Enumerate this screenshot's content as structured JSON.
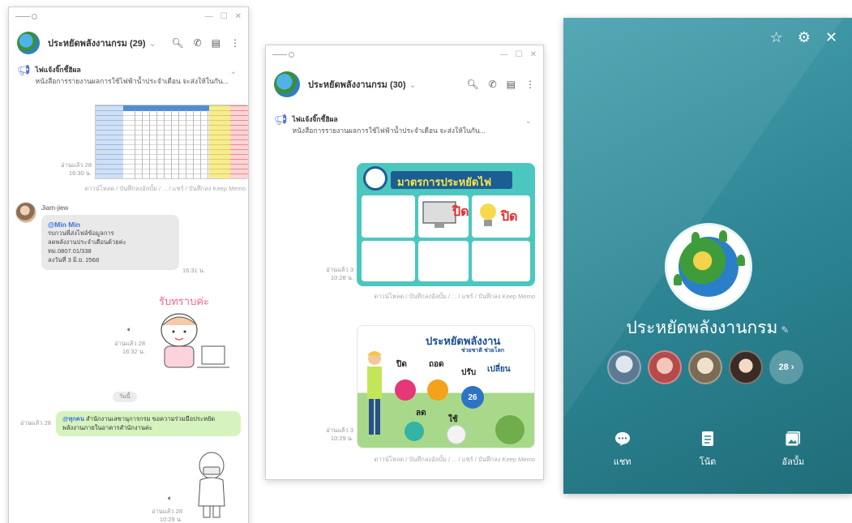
{
  "window1": {
    "chat_title": "ประหยัดพลังงานกรม (29)",
    "announcement_title": "ไฟแจ้งจิ๊กชี้ฮิผล",
    "announcement_text": "หนังสือการรายงานผลการใช้ไฟฟ้าน้ำประจำเดือน จะส่งให้ในกัน...",
    "image_meta": {
      "read": "อ่านแล้ว 28",
      "time": "16:30 น."
    },
    "actions": "ดาวน์โหลด / บันทึกลงอัลบั้ม / ... / แชร์ / บันทึกลง Keep Memo",
    "sender_name": "Jiam-jiew",
    "bubble": {
      "mention": "@Min Min",
      "lines": [
        "รบกวนพี่ส่งไฟล์ข้อมูลการ",
        "ลดพลังงานประจำเดือนด้วยค่ะ",
        "ทม.0807.01/338",
        "ลงวันที่ 3 มิ.ย. 2568"
      ],
      "time": "16:31 น."
    },
    "sticker_text": "รับทราบค่ะ",
    "sticker_meta": {
      "read": "อ่านแล้ว 28",
      "time": "16:32 น."
    },
    "date_chip": "วันนี้",
    "green_bubble": {
      "mention": "@ทุกคน",
      "text": "สำนักงานเลขานุการกรม ขอความร่วมมือประหยัดพลังงานภายในอาคารสำนักงานค่ะ",
      "read": "อ่านแล้ว 28"
    },
    "sticker2_meta": {
      "read": "อ่านแล้ว 28",
      "time": "10:29 น."
    }
  },
  "window2": {
    "chat_title": "ประหยัดพลังงานกรม (30)",
    "announcement_title": "ไฟแจ้งจิ๊กชี้ฮิผล",
    "announcement_text": "หนังสือการรายงานผลการใช้ไฟฟ้าน้ำประจำเดือน จะส่งให้ในกัน...",
    "poster1": {
      "banner": "มาตรการประหยัดไฟ",
      "meta_read": "อ่านแล้ว 3",
      "meta_time": "10:28 น.",
      "word1": "ปิด",
      "word2": "ปิด"
    },
    "actions1": "ดาวน์โหลด / บันทึกลงอัลบั้ม / ... / แชร์ / บันทึกลง Keep Memo",
    "poster2": {
      "title": "ประหยัดพลังงาน",
      "subtitle": "ช่วยชาติ ช่วยโลก",
      "words": [
        "ปิด",
        "ถอด",
        "ปรับ",
        "เปลี่ยน",
        "ลด",
        "ใช้"
      ],
      "number": "26",
      "meta_read": "อ่านแล้ว 3",
      "meta_time": "10:29 น."
    },
    "actions2": "ดาวน์โหลด / บันทึกลงอัลบั้ม / ... / แชร์ / บันทึกลง Keep Memo"
  },
  "profile": {
    "group_name": "ประหยัดพลังงานกรม",
    "member_count": "28",
    "actions": [
      {
        "label": "แชท",
        "icon": "chat-icon"
      },
      {
        "label": "โน้ต",
        "icon": "note-icon"
      },
      {
        "label": "อัลบั้ม",
        "icon": "album-icon"
      }
    ]
  },
  "colors": {
    "profile_bg": "#2c8493",
    "green_bubble": "#d6f3bf",
    "accent_blue": "#3b73d9"
  }
}
